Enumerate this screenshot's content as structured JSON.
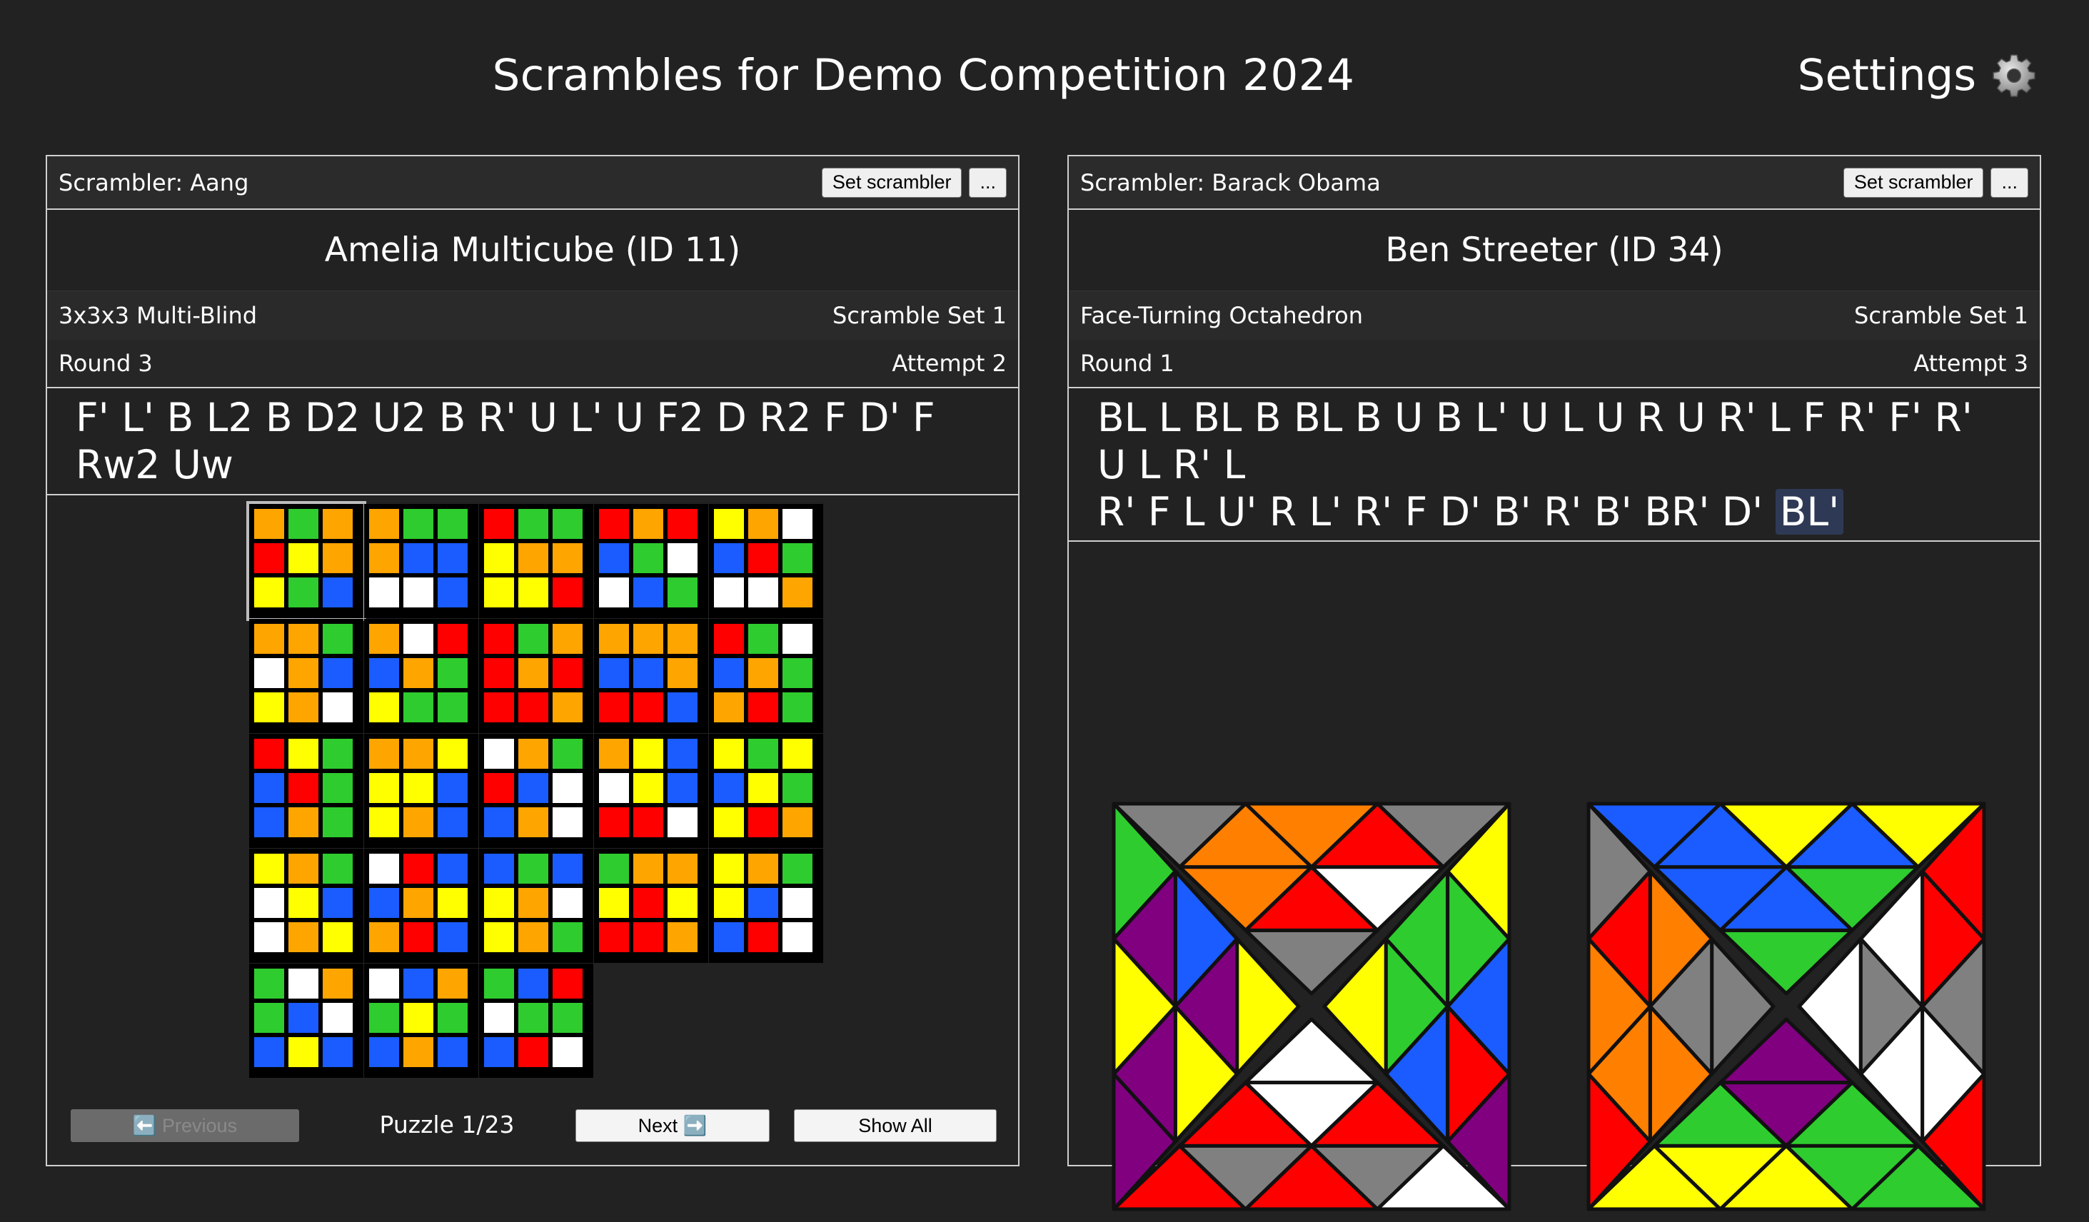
{
  "header": {
    "title": "Scrambles for Demo Competition 2024",
    "settings_label": "Settings",
    "settings_icon": "gear-icon"
  },
  "left_panel": {
    "scrambler": "Scrambler: Aang",
    "set_scrambler_label": "Set scrambler",
    "more_label": "...",
    "competitor": "Amelia Multicube (ID 11)",
    "event": "3x3x3 Multi-Blind",
    "scramble_set": "Scramble Set 1",
    "round": "Round 3",
    "attempt": "Attempt 2",
    "scramble": "F' L' B L2 B D2 U2 B R' U L' U F2 D R2 F D' F Rw2 Uw",
    "puzzle_counter": "Puzzle 1/23",
    "prev_label": "⬅️ Previous",
    "next_label": "Next ➡️",
    "show_all_label": "Show All",
    "colors": {
      "W": "#ffffff",
      "Y": "#ffff00",
      "R": "#ff0000",
      "O": "#ffa500",
      "G": "#2ecc2e",
      "B": "#1a5cff"
    },
    "cubes": [
      "OGORYOYGB",
      "OGGOBBWWB",
      "RGGYOOYYR",
      "RORBGWWBG",
      "YOWBRGWWO",
      "OOGWOBYOW",
      "OWRBOGYGG",
      "RGORORRRO",
      "OOOBBORRB",
      "RGWBOGORG",
      "RYGBRGBOG",
      "OOYYYBYOB",
      "WOGRBWBOW",
      "OYBWYBRRW",
      "YGYBYGYRO",
      "YOGWYBWOY",
      "WRBBOYORB",
      "BGBYOWYOG",
      "GOOYRYRRO",
      "YOGYBWBRW",
      "GWOGBWBYB",
      "WBOGYGBOB",
      "GBRWGGBRW"
    ]
  },
  "right_panel": {
    "scrambler": "Scrambler: Barack Obama",
    "set_scrambler_label": "Set scrambler",
    "more_label": "...",
    "competitor": "Ben Streeter (ID 34)",
    "event": "Face-Turning Octahedron",
    "scramble_set": "Scramble Set 1",
    "round": "Round 1",
    "attempt": "Attempt 3",
    "scramble_line1": "BL L BL B BL B U B L' U L U R U R' L F R' F' R' U L R' L",
    "scramble_line2": "R' F L U' R L' R' F D' B' R' B' BR' D'",
    "scramble_current": "BL'",
    "fto_colors": {
      "O": "#ff7f00",
      "Gy": "#808080",
      "R": "#ff0000",
      "W": "#ffffff",
      "Y": "#ffff00",
      "P": "#800080",
      "G": "#2ecc2e",
      "B": "#1a5cff"
    }
  }
}
